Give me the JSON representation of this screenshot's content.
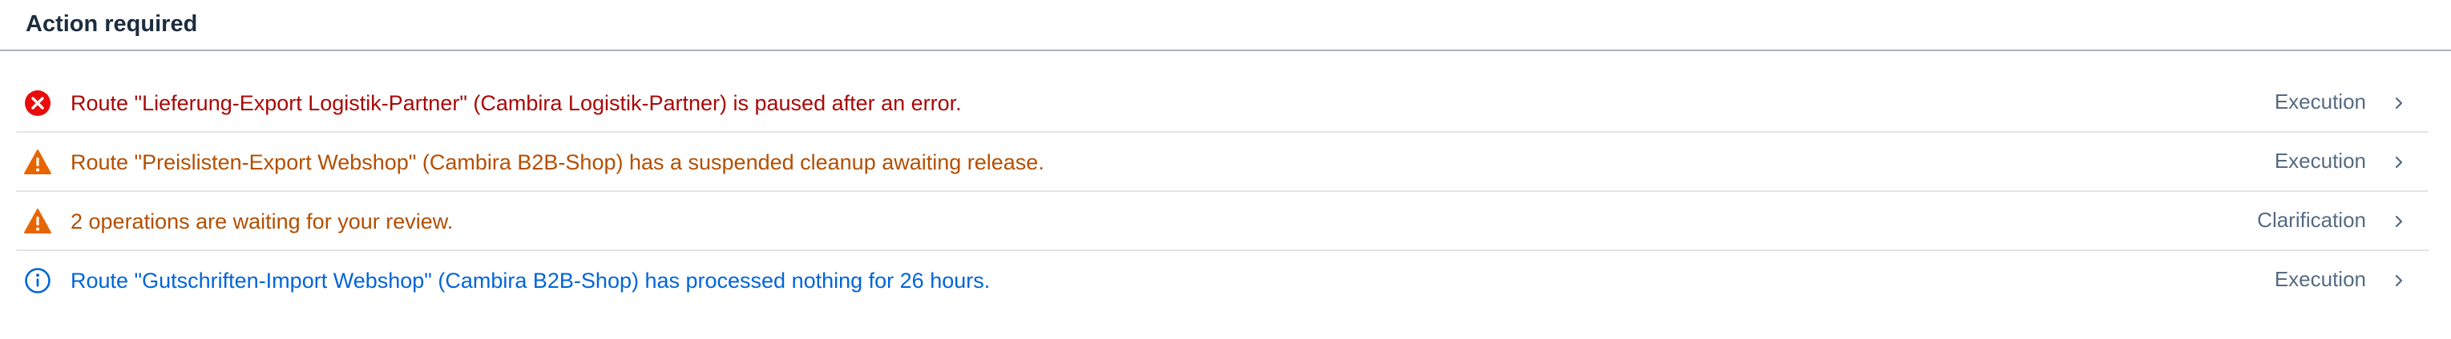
{
  "header": {
    "title": "Action required"
  },
  "colors": {
    "error": "#aa0808",
    "warning": "#b44f00",
    "info": "#0064d9",
    "error_icon": "#e90b0b",
    "warning_icon": "#e76500",
    "info_icon": "#0064d9",
    "category_text": "#556b82"
  },
  "items": [
    {
      "type": "error",
      "icon": "error-circle-icon",
      "message": "Route \"Lieferung-Export Logistik-Partner\" (Cambira Logistik-Partner) is paused after an error.",
      "category": "Execution"
    },
    {
      "type": "warning",
      "icon": "warning-triangle-icon",
      "message": "Route \"Preislisten-Export Webshop\" (Cambira B2B-Shop) has a suspended cleanup awaiting release.",
      "category": "Execution"
    },
    {
      "type": "warning",
      "icon": "warning-triangle-icon",
      "message": "2 operations are waiting for your review.",
      "category": "Clarification"
    },
    {
      "type": "info",
      "icon": "info-circle-icon",
      "message": "Route \"Gutschriften-Import Webshop\" (Cambira B2B-Shop) has processed nothing for 26 hours.",
      "category": "Execution"
    }
  ]
}
